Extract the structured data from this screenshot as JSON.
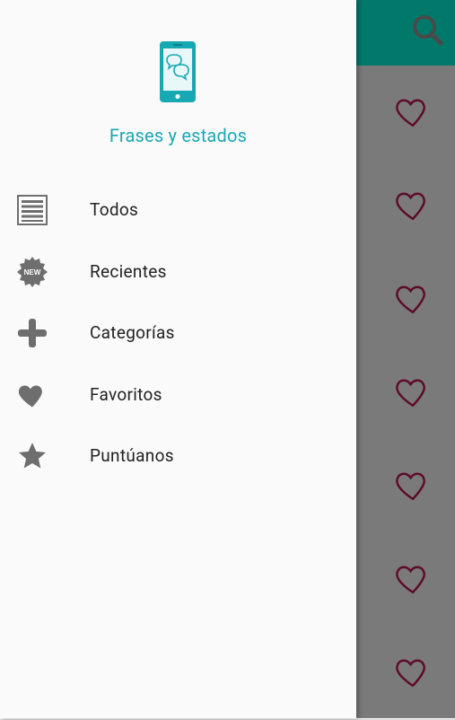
{
  "drawer": {
    "app_title": "Frases y estados",
    "items": [
      {
        "label": "Todos",
        "icon": "list-icon"
      },
      {
        "label": "Recientes",
        "icon": "new-badge-icon",
        "badge_text": "NEW"
      },
      {
        "label": "Categorías",
        "icon": "plus-icon"
      },
      {
        "label": "Favoritos",
        "icon": "heart-icon"
      },
      {
        "label": "Puntúanos",
        "icon": "star-icon"
      }
    ]
  },
  "background": {
    "toolbar_color": "#00796b",
    "accent_color": "#1aa8b4",
    "favorite_heart_color": "#c2185b",
    "row_count": 7,
    "search_icon": "search-icon"
  }
}
